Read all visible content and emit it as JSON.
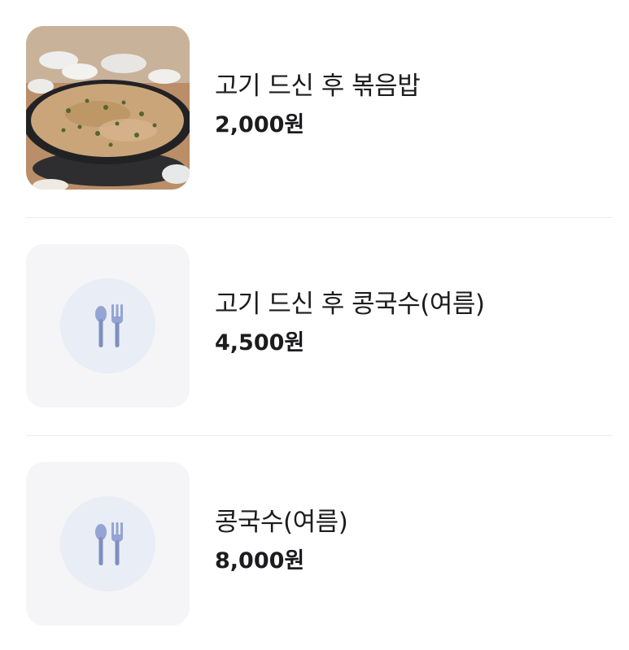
{
  "menu": {
    "items": [
      {
        "name": "고기 드신 후 볶음밥",
        "price": "2,000원",
        "image": "fried-rice-photo"
      },
      {
        "name": "고기 드신 후 콩국수(여름)",
        "price": "4,500원",
        "image": "utensils-placeholder-icon"
      },
      {
        "name": "콩국수(여름)",
        "price": "8,000원",
        "image": "utensils-placeholder-icon"
      }
    ]
  },
  "colors": {
    "text": "#1c1c1e",
    "placeholder_bg": "#f5f5f7",
    "placeholder_circle": "#e9edf5",
    "icon": "#7f8fbf",
    "divider": "#ececee"
  }
}
